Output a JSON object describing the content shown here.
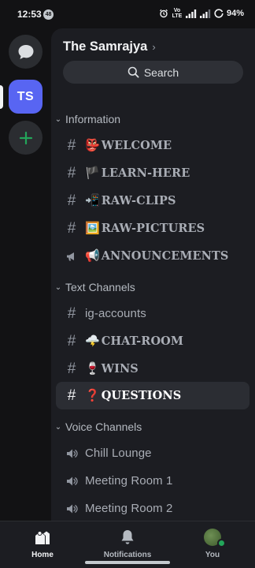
{
  "status_bar": {
    "time": "12:53",
    "notif_badge": "48",
    "network": "Vo LTE",
    "battery": "94%"
  },
  "rail": {
    "server_initials": "TS"
  },
  "server": {
    "name": "The Samrajya",
    "search_label": "Search"
  },
  "categories": {
    "information": "Information",
    "text": "Text Channels",
    "voice": "Voice Channels"
  },
  "channels": {
    "welcome": {
      "emoji": "👺",
      "name": "WELCOME"
    },
    "learn": {
      "emoji": "🏴",
      "name": "LEARN-HERE"
    },
    "clips": {
      "emoji": "📲",
      "name": "RAW-CLIPS"
    },
    "pictures": {
      "emoji": "🖼️",
      "name": "RAW-PICTURES"
    },
    "announcements": {
      "emoji": "📢",
      "name": "ANNOUNCEMENTS"
    },
    "ig": {
      "name": "ig-accounts"
    },
    "chat": {
      "emoji": "🌩️",
      "name": "CHAT-ROOM"
    },
    "wins": {
      "emoji": "🍷",
      "name": "WINS"
    },
    "questions": {
      "emoji": "❓",
      "name": "QUESTIONS"
    },
    "chill": {
      "name": "Chill Lounge"
    },
    "meeting1": {
      "name": "Meeting Room 1"
    },
    "meeting2": {
      "name": "Meeting Room 2"
    }
  },
  "bottom_nav": {
    "home": "Home",
    "notifications": "Notifications",
    "you": "You"
  },
  "colors": {
    "accent": "#5865f2",
    "online": "#23a55a",
    "add_server": "#23a55a"
  }
}
